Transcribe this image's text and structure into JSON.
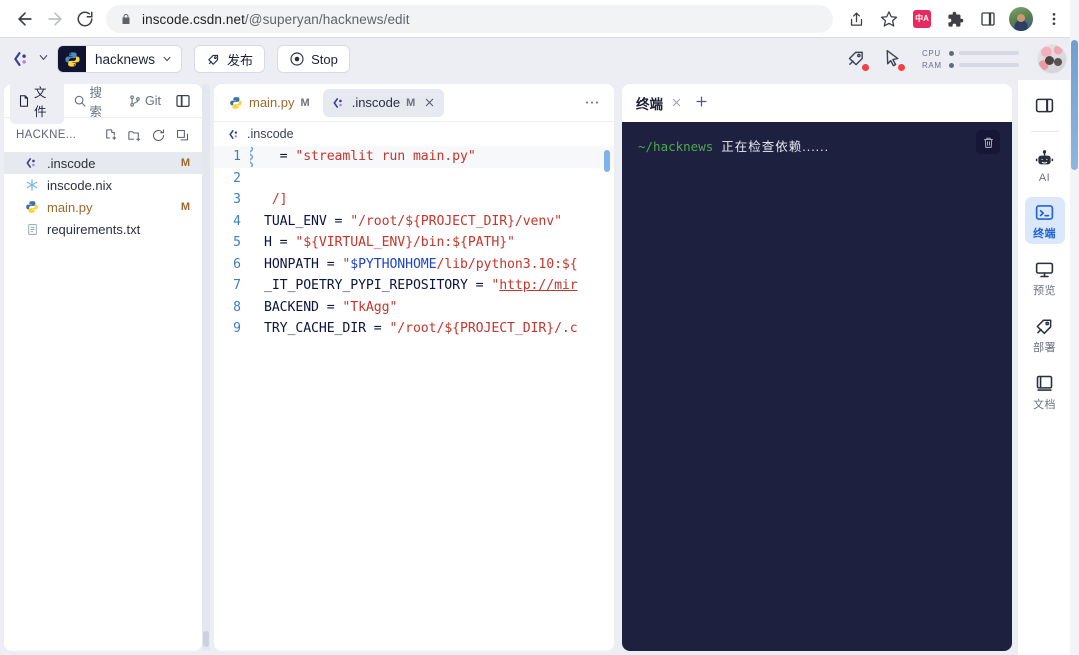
{
  "browser": {
    "back_icon": "arrow-left-icon",
    "forward_icon": "arrow-right-icon",
    "reload_icon": "reload-icon",
    "lock_icon": "lock-icon",
    "url_host": "inscode.csdn.net",
    "url_path": "/@superyan/hacknews/edit",
    "share_icon": "share-icon",
    "bookmark_icon": "star-icon",
    "translate_icon": "translate-extension-icon",
    "translate_label": "中A",
    "extensions_icon": "puzzle-icon",
    "sidepanel_icon": "side-panel-icon",
    "profile_icon": "profile-avatar",
    "menu_icon": "three-dot-menu-icon"
  },
  "toolbar": {
    "logo_icon": "inscode-logo-icon",
    "logo_chevron_icon": "chevron-down-icon",
    "project_icon": "python-icon",
    "project_name": "hacknews",
    "project_chevron_icon": "chevron-down-icon",
    "publish_icon": "rocket-icon",
    "publish_label": "发布",
    "stop_icon": "stop-circle-icon",
    "stop_label": "Stop",
    "deploy_icon": "rocket-alert-icon",
    "cursor_icon": "cursor-alert-icon",
    "cpu_label": "CPU",
    "ram_label": "RAM",
    "avatar_icon": "user-avatar"
  },
  "sidebar": {
    "tabs": [
      {
        "label": "文件",
        "icon": "file-icon",
        "active": true
      },
      {
        "label": "搜索",
        "icon": "search-icon",
        "active": false
      },
      {
        "label": "Git",
        "icon": "git-branch-icon",
        "active": false
      }
    ],
    "layout_toggle_icon": "split-layout-icon",
    "explorer_title": "HACKNE...",
    "actions": [
      {
        "icon": "new-file-icon"
      },
      {
        "icon": "new-folder-icon"
      },
      {
        "icon": "refresh-icon"
      },
      {
        "icon": "collapse-all-icon"
      }
    ],
    "files": [
      {
        "name": ".inscode",
        "icon": "inscode-file-icon",
        "status": "M",
        "selected": true,
        "modified": false
      },
      {
        "name": "inscode.nix",
        "icon": "nix-snowflake-icon",
        "status": "",
        "selected": false,
        "modified": false
      },
      {
        "name": "main.py",
        "icon": "python-file-icon",
        "status": "M",
        "selected": false,
        "modified": true
      },
      {
        "name": "requirements.txt",
        "icon": "text-file-icon",
        "status": "",
        "selected": false,
        "modified": false
      }
    ]
  },
  "editor": {
    "tabs": [
      {
        "name": "main.py",
        "icon": "python-file-icon",
        "status": "M",
        "active": false,
        "modified": true,
        "closable": false
      },
      {
        "name": ".inscode",
        "icon": "inscode-file-icon",
        "status": "M",
        "active": true,
        "modified": false,
        "closable": true
      }
    ],
    "more_icon": "more-horizontal-icon",
    "breadcrumb_icon": "inscode-file-icon",
    "breadcrumb": ".inscode",
    "lines": [
      {
        "n": "1",
        "current": true,
        "has_marker": true,
        "segments": [
          {
            "t": "  = ",
            "c": "p"
          },
          {
            "t": "\"streamlit run main.py\"",
            "c": "s"
          }
        ]
      },
      {
        "n": "2",
        "current": false,
        "has_marker": false,
        "segments": []
      },
      {
        "n": "3",
        "current": false,
        "has_marker": false,
        "segments": [
          {
            "t": " /]",
            "c": "s"
          }
        ]
      },
      {
        "n": "4",
        "current": false,
        "has_marker": false,
        "segments": [
          {
            "t": "TUAL_ENV = ",
            "c": "p"
          },
          {
            "t": "\"/root/${PROJECT_DIR}/venv\"",
            "c": "s"
          }
        ]
      },
      {
        "n": "5",
        "current": false,
        "has_marker": false,
        "segments": [
          {
            "t": "H = ",
            "c": "p"
          },
          {
            "t": "\"${VIRTUAL_ENV}/bin:${PATH}\"",
            "c": "s"
          }
        ]
      },
      {
        "n": "6",
        "current": false,
        "has_marker": false,
        "segments": [
          {
            "t": "HONPATH = ",
            "c": "p"
          },
          {
            "t": "\"",
            "c": "s"
          },
          {
            "t": "$PYTHONHOME",
            "c": "v"
          },
          {
            "t": "/lib/python3.10:${",
            "c": "s"
          }
        ]
      },
      {
        "n": "7",
        "current": false,
        "has_marker": false,
        "segments": [
          {
            "t": "_IT_POETRY_PYPI_REPOSITORY = ",
            "c": "p"
          },
          {
            "t": "\"",
            "c": "s"
          },
          {
            "t": "http://mir",
            "c": "u"
          }
        ]
      },
      {
        "n": "8",
        "current": false,
        "has_marker": false,
        "segments": [
          {
            "t": "BACKEND = ",
            "c": "p"
          },
          {
            "t": "\"TkAgg\"",
            "c": "s"
          }
        ]
      },
      {
        "n": "9",
        "current": false,
        "has_marker": false,
        "segments": [
          {
            "t": "TRY_CACHE_DIR = ",
            "c": "p"
          },
          {
            "t": "\"/root/${PROJECT_DIR}/.c",
            "c": "s"
          }
        ]
      }
    ]
  },
  "terminal": {
    "tab_label": "终端",
    "close_icon": "close-icon",
    "add_icon": "plus-icon",
    "trash_icon": "trash-icon",
    "prompt": "~/hacknews",
    "message": "正在检查依赖......"
  },
  "rail": {
    "layout_icon": "panel-layout-icon",
    "items": [
      {
        "label": "AI",
        "icon": "robot-icon",
        "active": false
      },
      {
        "label": "终端",
        "icon": "terminal-icon",
        "active": true
      },
      {
        "label": "预览",
        "icon": "monitor-icon",
        "active": false
      },
      {
        "label": "部署",
        "icon": "rocket-icon",
        "active": false
      },
      {
        "label": "文档",
        "icon": "book-icon",
        "active": false
      }
    ]
  },
  "colors": {
    "app_bg": "#eceef3",
    "terminal_bg": "#1e2040",
    "accent_blue": "#1f63d6",
    "modified_orange": "#9a6b2f",
    "string_red": "#c5362c",
    "prompt_green": "#4fa84f"
  }
}
